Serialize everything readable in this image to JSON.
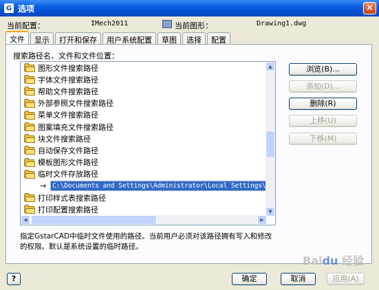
{
  "window": {
    "title": "选项",
    "close_label": "×"
  },
  "config": {
    "current_profile_label": "当前配置：",
    "current_profile_value": "IMech2011",
    "current_drawing_label": "当前图形：",
    "current_drawing_value": "Drawing1.dwg"
  },
  "tabs": [
    "文件",
    "显示",
    "打开和保存",
    "用户系统配置",
    "草图",
    "选择",
    "配置"
  ],
  "panel": {
    "label": "搜索路径名、文件和文件位置：",
    "tree": [
      "图形文件搜索路径",
      "字体文件搜索路径",
      "帮助文件搜索路径",
      "外部参照文件搜索路径",
      "菜单文件搜索路径",
      "图案填充文件搜索路径",
      "块文件搜索路径",
      "自动保存文件路径",
      "模板图形文件路径",
      "临时文件存放路径"
    ],
    "selected_path": "C:\\Documents and Settings\\Administrator\\Local Settings\\Temp\\",
    "tree_after": [
      "打印样式表搜索路径",
      "打印配置搜索路径"
    ],
    "side_buttons": {
      "browse": "浏览(B)...",
      "add": "添加(D)...",
      "delete": "删除(R)",
      "move_up": "上移(U)",
      "move_down": "下移(M)"
    },
    "description": "指定GstarCAD中临时文件使用的路径。当前用户必须对该路径拥有写入和修改的权限。默认是系统设置的临时路径。"
  },
  "footer": {
    "help": "?",
    "ok": "确定",
    "cancel": "取消",
    "apply": "应用(A)"
  },
  "watermark": "Baidu 经验"
}
